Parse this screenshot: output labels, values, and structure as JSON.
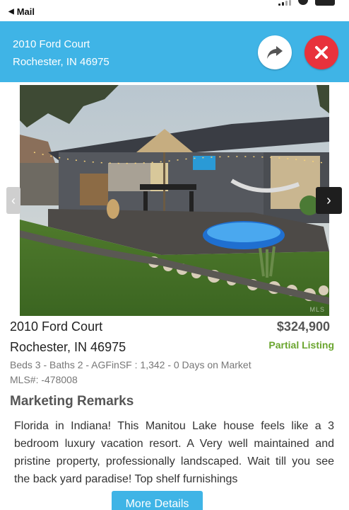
{
  "status_bar": {
    "back_app": "Mail"
  },
  "header": {
    "address_line1": "2010 Ford Court",
    "address_line2": "Rochester, IN 46975",
    "share_icon": "share-arrow-icon",
    "close_icon": "close-x-icon",
    "colors": {
      "header_bg": "#3fb4e6",
      "close_bg": "#e8323c"
    }
  },
  "photo": {
    "description_icon": "listing-photo",
    "watermark": "MLS"
  },
  "listing": {
    "street": "2010 Ford Court",
    "city_state_zip": "Rochester, IN 46975",
    "price": "$324,900",
    "status": "Partial Listing",
    "details": "Beds 3 - Baths 2 - AGFinSF : 1,342 - 0 Days on Market",
    "mls": "MLS#: -478008"
  },
  "remarks": {
    "title": "Marketing Remarks",
    "text": "Florida in Indiana! This Manitou Lake house feels like a 3 bedroom luxury vacation resort. A Very well maintained and pristine property, professionally landscaped. Wait till you see the back yard paradise! Top shelf furnishings"
  },
  "more_button": {
    "label": "More Details"
  }
}
